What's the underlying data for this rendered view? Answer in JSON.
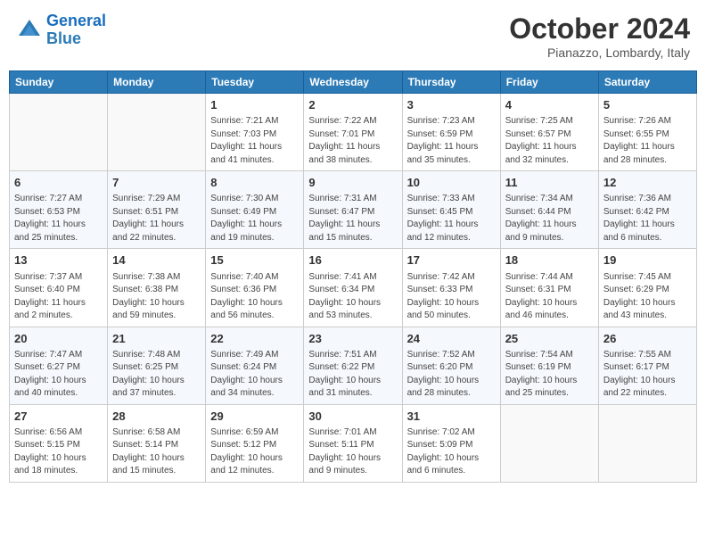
{
  "header": {
    "logo_line1": "General",
    "logo_line2": "Blue",
    "month": "October 2024",
    "location": "Pianazzo, Lombardy, Italy"
  },
  "weekdays": [
    "Sunday",
    "Monday",
    "Tuesday",
    "Wednesday",
    "Thursday",
    "Friday",
    "Saturday"
  ],
  "weeks": [
    [
      {
        "day": "",
        "info": ""
      },
      {
        "day": "",
        "info": ""
      },
      {
        "day": "1",
        "info": "Sunrise: 7:21 AM\nSunset: 7:03 PM\nDaylight: 11 hours and 41 minutes."
      },
      {
        "day": "2",
        "info": "Sunrise: 7:22 AM\nSunset: 7:01 PM\nDaylight: 11 hours and 38 minutes."
      },
      {
        "day": "3",
        "info": "Sunrise: 7:23 AM\nSunset: 6:59 PM\nDaylight: 11 hours and 35 minutes."
      },
      {
        "day": "4",
        "info": "Sunrise: 7:25 AM\nSunset: 6:57 PM\nDaylight: 11 hours and 32 minutes."
      },
      {
        "day": "5",
        "info": "Sunrise: 7:26 AM\nSunset: 6:55 PM\nDaylight: 11 hours and 28 minutes."
      }
    ],
    [
      {
        "day": "6",
        "info": "Sunrise: 7:27 AM\nSunset: 6:53 PM\nDaylight: 11 hours and 25 minutes."
      },
      {
        "day": "7",
        "info": "Sunrise: 7:29 AM\nSunset: 6:51 PM\nDaylight: 11 hours and 22 minutes."
      },
      {
        "day": "8",
        "info": "Sunrise: 7:30 AM\nSunset: 6:49 PM\nDaylight: 11 hours and 19 minutes."
      },
      {
        "day": "9",
        "info": "Sunrise: 7:31 AM\nSunset: 6:47 PM\nDaylight: 11 hours and 15 minutes."
      },
      {
        "day": "10",
        "info": "Sunrise: 7:33 AM\nSunset: 6:45 PM\nDaylight: 11 hours and 12 minutes."
      },
      {
        "day": "11",
        "info": "Sunrise: 7:34 AM\nSunset: 6:44 PM\nDaylight: 11 hours and 9 minutes."
      },
      {
        "day": "12",
        "info": "Sunrise: 7:36 AM\nSunset: 6:42 PM\nDaylight: 11 hours and 6 minutes."
      }
    ],
    [
      {
        "day": "13",
        "info": "Sunrise: 7:37 AM\nSunset: 6:40 PM\nDaylight: 11 hours and 2 minutes."
      },
      {
        "day": "14",
        "info": "Sunrise: 7:38 AM\nSunset: 6:38 PM\nDaylight: 10 hours and 59 minutes."
      },
      {
        "day": "15",
        "info": "Sunrise: 7:40 AM\nSunset: 6:36 PM\nDaylight: 10 hours and 56 minutes."
      },
      {
        "day": "16",
        "info": "Sunrise: 7:41 AM\nSunset: 6:34 PM\nDaylight: 10 hours and 53 minutes."
      },
      {
        "day": "17",
        "info": "Sunrise: 7:42 AM\nSunset: 6:33 PM\nDaylight: 10 hours and 50 minutes."
      },
      {
        "day": "18",
        "info": "Sunrise: 7:44 AM\nSunset: 6:31 PM\nDaylight: 10 hours and 46 minutes."
      },
      {
        "day": "19",
        "info": "Sunrise: 7:45 AM\nSunset: 6:29 PM\nDaylight: 10 hours and 43 minutes."
      }
    ],
    [
      {
        "day": "20",
        "info": "Sunrise: 7:47 AM\nSunset: 6:27 PM\nDaylight: 10 hours and 40 minutes."
      },
      {
        "day": "21",
        "info": "Sunrise: 7:48 AM\nSunset: 6:25 PM\nDaylight: 10 hours and 37 minutes."
      },
      {
        "day": "22",
        "info": "Sunrise: 7:49 AM\nSunset: 6:24 PM\nDaylight: 10 hours and 34 minutes."
      },
      {
        "day": "23",
        "info": "Sunrise: 7:51 AM\nSunset: 6:22 PM\nDaylight: 10 hours and 31 minutes."
      },
      {
        "day": "24",
        "info": "Sunrise: 7:52 AM\nSunset: 6:20 PM\nDaylight: 10 hours and 28 minutes."
      },
      {
        "day": "25",
        "info": "Sunrise: 7:54 AM\nSunset: 6:19 PM\nDaylight: 10 hours and 25 minutes."
      },
      {
        "day": "26",
        "info": "Sunrise: 7:55 AM\nSunset: 6:17 PM\nDaylight: 10 hours and 22 minutes."
      }
    ],
    [
      {
        "day": "27",
        "info": "Sunrise: 6:56 AM\nSunset: 5:15 PM\nDaylight: 10 hours and 18 minutes."
      },
      {
        "day": "28",
        "info": "Sunrise: 6:58 AM\nSunset: 5:14 PM\nDaylight: 10 hours and 15 minutes."
      },
      {
        "day": "29",
        "info": "Sunrise: 6:59 AM\nSunset: 5:12 PM\nDaylight: 10 hours and 12 minutes."
      },
      {
        "day": "30",
        "info": "Sunrise: 7:01 AM\nSunset: 5:11 PM\nDaylight: 10 hours and 9 minutes."
      },
      {
        "day": "31",
        "info": "Sunrise: 7:02 AM\nSunset: 5:09 PM\nDaylight: 10 hours and 6 minutes."
      },
      {
        "day": "",
        "info": ""
      },
      {
        "day": "",
        "info": ""
      }
    ]
  ]
}
